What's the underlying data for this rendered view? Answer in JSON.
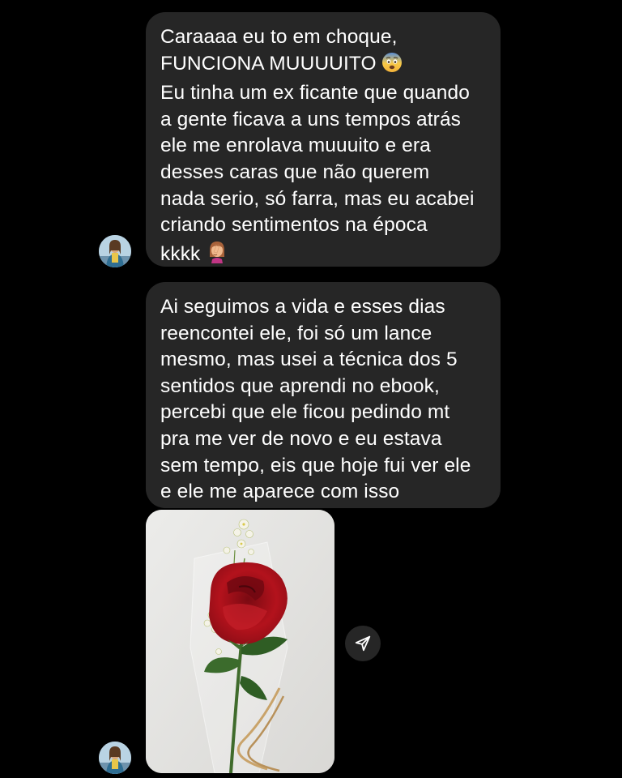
{
  "thread": {
    "message_1": {
      "lines": [
        "Caraaaa eu to em choque,",
        "FUNCIONA MUUUUITO",
        "Eu tinha um ex ficante que quando",
        "a gente ficava a uns tempos atrás",
        "ele me enrolava muuuito e era",
        "desses caras que não querem",
        "nada serio, só farra, mas eu acabei",
        "criando sentimentos na época",
        "kkkk"
      ],
      "emoji_1": "fearful-face-emoji",
      "emoji_2": "woman-facepalming-emoji"
    },
    "message_2": {
      "lines": [
        "Ai seguimos a vida e esses dias",
        "reencontei ele, foi só um lance",
        "mesmo, mas usei a técnica dos 5",
        "sentidos que aprendi no ebook,",
        "percebi que ele ficou pedindo mt",
        "pra me ver de novo e eu estava",
        "sem tempo, eis que hoje fui ver ele",
        "e ele me aparece com isso"
      ]
    },
    "photo": {
      "subject": "red-rose-bouquet-image"
    },
    "share_icon": "send-paper-plane-icon"
  },
  "colors": {
    "background": "#000000",
    "bubble": "#262626",
    "text": "#ffffff",
    "rose": "#b3121c"
  }
}
